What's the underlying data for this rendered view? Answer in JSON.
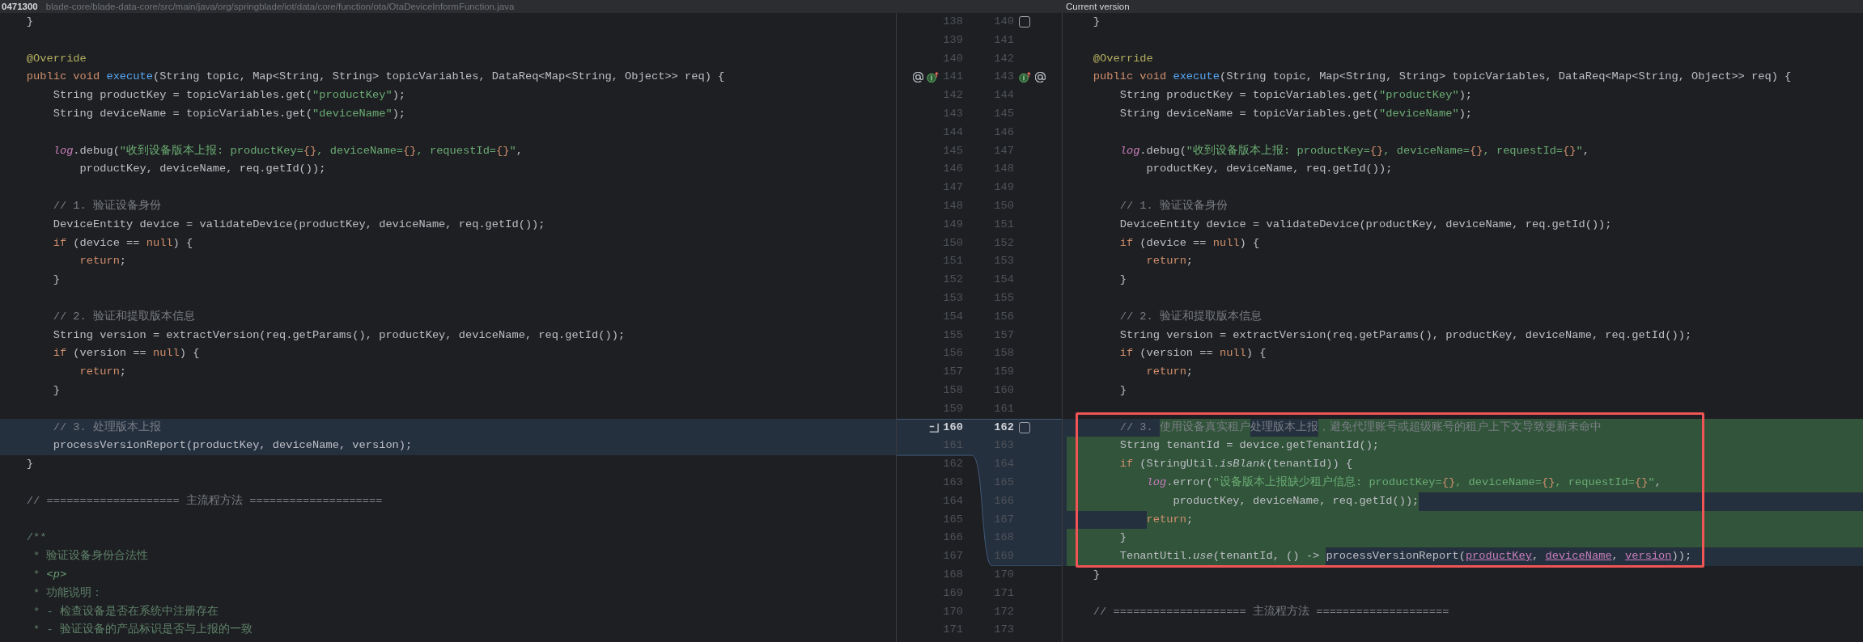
{
  "header": {
    "revision": "0471300",
    "path": "blade-core/blade-data-core/src/main/java/org/springblade/iot/data/core/function/ota/OtaDeviceInformFunction.java",
    "right_title": "Current version"
  },
  "left_pane": {
    "lines": [
      {
        "modified": false,
        "tokens": [
          {
            "kind": "plain",
            "text": "    }"
          }
        ]
      },
      {
        "modified": false
      },
      {
        "modified": false,
        "tokens": [
          {
            "kind": "annotation",
            "text": "    @Override"
          }
        ]
      },
      {
        "modified": false,
        "tokens": [
          {
            "kind": "keyword",
            "text": "    public void"
          },
          {
            "kind": "declaration",
            "text": " execute"
          },
          {
            "kind": "plain",
            "text": "(String topic, Map<String, String> topicVariables, DataReq<Map<String, Object>> req) {"
          }
        ]
      },
      {
        "modified": false,
        "tokens": [
          {
            "kind": "plain",
            "text": "        String productKey = topicVariables.get("
          },
          {
            "kind": "string",
            "text": "\"productKey\""
          },
          {
            "kind": "plain",
            "text": ");"
          }
        ]
      },
      {
        "modified": false,
        "tokens": [
          {
            "kind": "plain",
            "text": "        String deviceName = topicVariables.get("
          },
          {
            "kind": "string",
            "text": "\"deviceName\""
          },
          {
            "kind": "plain",
            "text": ");"
          }
        ]
      },
      {
        "modified": false
      },
      {
        "modified": false,
        "tokens": [
          {
            "kind": "field",
            "text": "        log"
          },
          {
            "kind": "plain",
            "text": ".debug("
          },
          {
            "kind": "string",
            "text": "\"收到设备版本上报: productKey="
          },
          {
            "kind": "placeholder",
            "text": "{}"
          },
          {
            "kind": "string",
            "text": ", deviceName="
          },
          {
            "kind": "placeholder",
            "text": "{}"
          },
          {
            "kind": "string",
            "text": ", requestId="
          },
          {
            "kind": "placeholder",
            "text": "{}"
          },
          {
            "kind": "string",
            "text": "\""
          },
          {
            "kind": "plain",
            "text": ","
          }
        ]
      },
      {
        "modified": false,
        "tokens": [
          {
            "kind": "plain",
            "text": "            productKey, deviceName, req.getId());"
          }
        ]
      },
      {
        "modified": false
      },
      {
        "modified": false,
        "tokens": [
          {
            "kind": "comment",
            "text": "        // 1. 验证设备身份"
          }
        ]
      },
      {
        "modified": false,
        "tokens": [
          {
            "kind": "plain",
            "text": "        DeviceEntity device = validateDevice(productKey, deviceName, req.getId());"
          }
        ]
      },
      {
        "modified": false,
        "tokens": [
          {
            "kind": "keyword",
            "text": "        if"
          },
          {
            "kind": "plain",
            "text": " (device == "
          },
          {
            "kind": "keyword",
            "text": "null"
          },
          {
            "kind": "plain",
            "text": ") {"
          }
        ]
      },
      {
        "modified": false,
        "tokens": [
          {
            "kind": "keyword",
            "text": "            return"
          },
          {
            "kind": "plain",
            "text": ";"
          }
        ]
      },
      {
        "modified": false,
        "tokens": [
          {
            "kind": "plain",
            "text": "        }"
          }
        ]
      },
      {
        "modified": false
      },
      {
        "modified": false,
        "tokens": [
          {
            "kind": "comment",
            "text": "        // 2. 验证和提取版本信息"
          }
        ]
      },
      {
        "modified": false,
        "tokens": [
          {
            "kind": "plain",
            "text": "        String version = extractVersion(req.getParams(), productKey, deviceName, req.getId());"
          }
        ]
      },
      {
        "modified": false,
        "tokens": [
          {
            "kind": "keyword",
            "text": "        if"
          },
          {
            "kind": "plain",
            "text": " (version == "
          },
          {
            "kind": "keyword",
            "text": "null"
          },
          {
            "kind": "plain",
            "text": ") {"
          }
        ]
      },
      {
        "modified": false,
        "tokens": [
          {
            "kind": "keyword",
            "text": "            return"
          },
          {
            "kind": "plain",
            "text": ";"
          }
        ]
      },
      {
        "modified": false,
        "tokens": [
          {
            "kind": "plain",
            "text": "        }"
          }
        ]
      },
      {
        "modified": false
      },
      {
        "modified": true,
        "tokens": [
          {
            "kind": "comment",
            "text": "        // 3. 处理版本上报"
          }
        ]
      },
      {
        "modified": true,
        "tokens": [
          {
            "kind": "plain",
            "text": "        processVersionReport(productKey, deviceName, version);"
          }
        ]
      },
      {
        "modified": false,
        "tokens": [
          {
            "kind": "plain",
            "text": "    }"
          }
        ]
      },
      {
        "modified": false
      },
      {
        "modified": false,
        "tokens": [
          {
            "kind": "comment",
            "text": "    // ==================== 主流程方法 ===================="
          }
        ]
      },
      {
        "modified": false
      },
      {
        "modified": false,
        "tokens": [
          {
            "kind": "doc",
            "text": "    /**"
          }
        ]
      },
      {
        "modified": false,
        "tokens": [
          {
            "kind": "doc",
            "text": "     * 验证设备身份合法性"
          }
        ]
      },
      {
        "modified": false,
        "tokens": [
          {
            "kind": "doc",
            "text": "     * "
          },
          {
            "kind": "doc_tag",
            "text": "<p>"
          }
        ]
      },
      {
        "modified": false,
        "tokens": [
          {
            "kind": "doc",
            "text": "     * 功能说明："
          }
        ]
      },
      {
        "modified": false,
        "tokens": [
          {
            "kind": "doc",
            "text": "     * - 检查设备是否在系统中注册存在"
          }
        ]
      },
      {
        "modified": false,
        "tokens": [
          {
            "kind": "doc",
            "text": "     * - 验证设备的产品标识是否与上报的一致"
          }
        ]
      }
    ]
  },
  "gutter": {
    "rows": [
      {
        "left_number": "138",
        "right_number": "140",
        "current": false,
        "right_icons": [
          {
            "kind": "checkbox",
            "checked": false
          }
        ]
      },
      {
        "left_number": "139",
        "right_number": "141",
        "current": false
      },
      {
        "left_number": "140",
        "right_number": "142",
        "current": false
      },
      {
        "left_number": "141",
        "right_number": "143",
        "current": false,
        "left_icons": [
          {
            "kind": "override"
          },
          {
            "kind": "implements"
          }
        ],
        "right_icons": [
          {
            "kind": "implements"
          },
          {
            "kind": "override"
          }
        ]
      },
      {
        "left_number": "142",
        "right_number": "144",
        "current": false
      },
      {
        "left_number": "143",
        "right_number": "145",
        "current": false
      },
      {
        "left_number": "144",
        "right_number": "146",
        "current": false
      },
      {
        "left_number": "145",
        "right_number": "147",
        "current": false
      },
      {
        "left_number": "146",
        "right_number": "148",
        "current": false
      },
      {
        "left_number": "147",
        "right_number": "149",
        "current": false
      },
      {
        "left_number": "148",
        "right_number": "150",
        "current": false
      },
      {
        "left_number": "149",
        "right_number": "151",
        "current": false
      },
      {
        "left_number": "150",
        "right_number": "152",
        "current": false
      },
      {
        "left_number": "151",
        "right_number": "153",
        "current": false
      },
      {
        "left_number": "152",
        "right_number": "154",
        "current": false
      },
      {
        "left_number": "153",
        "right_number": "155",
        "current": false
      },
      {
        "left_number": "154",
        "right_number": "156",
        "current": false
      },
      {
        "left_number": "155",
        "right_number": "157",
        "current": false
      },
      {
        "left_number": "156",
        "right_number": "158",
        "current": false
      },
      {
        "left_number": "157",
        "right_number": "159",
        "current": false
      },
      {
        "left_number": "158",
        "right_number": "160",
        "current": false
      },
      {
        "left_number": "159",
        "right_number": "161",
        "current": false
      },
      {
        "left_number": "160",
        "right_number": "162",
        "current": true,
        "left_icons": [
          {
            "kind": "revert"
          }
        ],
        "right_icons": [
          {
            "kind": "checkbox",
            "checked": false
          }
        ]
      },
      {
        "left_number": "161",
        "right_number": "163",
        "current": false
      },
      {
        "left_number": "162",
        "right_number": "164",
        "current": false
      },
      {
        "left_number": "163",
        "right_number": "165",
        "current": false
      },
      {
        "left_number": "164",
        "right_number": "166",
        "current": false
      },
      {
        "left_number": "165",
        "right_number": "167",
        "current": false
      },
      {
        "left_number": "166",
        "right_number": "168",
        "current": false
      },
      {
        "left_number": "167",
        "right_number": "169",
        "current": false
      },
      {
        "left_number": "168",
        "right_number": "170",
        "current": false
      },
      {
        "left_number": "169",
        "right_number": "171",
        "current": false
      },
      {
        "left_number": "170",
        "right_number": "172",
        "current": false
      },
      {
        "left_number": "171",
        "right_number": "173",
        "current": false
      }
    ]
  },
  "right_pane": {
    "lines": [
      {
        "modified": false,
        "tokens": [
          {
            "kind": "plain",
            "text": "    }"
          }
        ]
      },
      {
        "modified": false
      },
      {
        "modified": false,
        "tokens": [
          {
            "kind": "annotation",
            "text": "    @Override"
          }
        ]
      },
      {
        "modified": false,
        "tokens": [
          {
            "kind": "keyword",
            "text": "    public void"
          },
          {
            "kind": "declaration",
            "text": " execute"
          },
          {
            "kind": "plain",
            "text": "(String topic, Map<String, String> topicVariables, DataReq<Map<String, Object>> req) {"
          }
        ]
      },
      {
        "modified": false,
        "tokens": [
          {
            "kind": "plain",
            "text": "        String productKey = topicVariables.get("
          },
          {
            "kind": "string",
            "text": "\"productKey\""
          },
          {
            "kind": "plain",
            "text": ");"
          }
        ]
      },
      {
        "modified": false,
        "tokens": [
          {
            "kind": "plain",
            "text": "        String deviceName = topicVariables.get("
          },
          {
            "kind": "string",
            "text": "\"deviceName\""
          },
          {
            "kind": "plain",
            "text": ");"
          }
        ]
      },
      {
        "modified": false
      },
      {
        "modified": false,
        "tokens": [
          {
            "kind": "field",
            "text": "        log"
          },
          {
            "kind": "plain",
            "text": ".debug("
          },
          {
            "kind": "string",
            "text": "\"收到设备版本上报: productKey="
          },
          {
            "kind": "placeholder",
            "text": "{}"
          },
          {
            "kind": "string",
            "text": ", deviceName="
          },
          {
            "kind": "placeholder",
            "text": "{}"
          },
          {
            "kind": "string",
            "text": ", requestId="
          },
          {
            "kind": "placeholder",
            "text": "{}"
          },
          {
            "kind": "string",
            "text": "\""
          },
          {
            "kind": "plain",
            "text": ","
          }
        ]
      },
      {
        "modified": false,
        "tokens": [
          {
            "kind": "plain",
            "text": "            productKey, deviceName, req.getId());"
          }
        ]
      },
      {
        "modified": false
      },
      {
        "modified": false,
        "tokens": [
          {
            "kind": "comment",
            "text": "        // 1. 验证设备身份"
          }
        ]
      },
      {
        "modified": false,
        "tokens": [
          {
            "kind": "plain",
            "text": "        DeviceEntity device = validateDevice(productKey, deviceName, req.getId());"
          }
        ]
      },
      {
        "modified": false,
        "tokens": [
          {
            "kind": "keyword",
            "text": "        if"
          },
          {
            "kind": "plain",
            "text": " (device == "
          },
          {
            "kind": "keyword",
            "text": "null"
          },
          {
            "kind": "plain",
            "text": ") {"
          }
        ]
      },
      {
        "modified": false,
        "tokens": [
          {
            "kind": "keyword",
            "text": "            return"
          },
          {
            "kind": "plain",
            "text": ";"
          }
        ]
      },
      {
        "modified": false,
        "tokens": [
          {
            "kind": "plain",
            "text": "        }"
          }
        ]
      },
      {
        "modified": false
      },
      {
        "modified": false,
        "tokens": [
          {
            "kind": "comment",
            "text": "        // 2. 验证和提取版本信息"
          }
        ]
      },
      {
        "modified": false,
        "tokens": [
          {
            "kind": "plain",
            "text": "        String version = extractVersion(req.getParams(), productKey, deviceName, req.getId());"
          }
        ]
      },
      {
        "modified": false,
        "tokens": [
          {
            "kind": "keyword",
            "text": "        if"
          },
          {
            "kind": "plain",
            "text": " (version == "
          },
          {
            "kind": "keyword",
            "text": "null"
          },
          {
            "kind": "plain",
            "text": ") {"
          }
        ]
      },
      {
        "modified": false,
        "tokens": [
          {
            "kind": "keyword",
            "text": "            return"
          },
          {
            "kind": "plain",
            "text": ";"
          }
        ]
      },
      {
        "modified": false,
        "tokens": [
          {
            "kind": "plain",
            "text": "        }"
          }
        ]
      },
      {
        "modified": false
      },
      {
        "modified": true,
        "indent_inserted": false,
        "end_inserted": true,
        "tokens": [
          {
            "kind": "comment",
            "text": "        // 3. ",
            "inserted": false
          },
          {
            "kind": "comment",
            "text": "使用设备真实租户",
            "inserted": true
          },
          {
            "kind": "comment",
            "text": "处理版本上报",
            "inserted": false
          },
          {
            "kind": "comment",
            "text": "，避免代理账号或超级账号的租户上下文导致更新未命中",
            "inserted": true
          }
        ]
      },
      {
        "modified": true,
        "indent_inserted": true,
        "end_inserted": true,
        "tokens": [
          {
            "kind": "plain",
            "text": "        String tenantId = device.getTenantId();",
            "inserted": true
          }
        ]
      },
      {
        "modified": true,
        "indent_inserted": true,
        "end_inserted": true,
        "tokens": [
          {
            "kind": "keyword",
            "text": "        if",
            "inserted": true
          },
          {
            "kind": "plain",
            "text": " (StringUtil.",
            "inserted": true
          },
          {
            "kind": "static_call",
            "text": "isBlank",
            "inserted": true
          },
          {
            "kind": "plain",
            "text": "(tenantId)) {",
            "inserted": true
          }
        ]
      },
      {
        "modified": true,
        "indent_inserted": true,
        "end_inserted": true,
        "tokens": [
          {
            "kind": "field",
            "text": "            log",
            "inserted": true
          },
          {
            "kind": "plain",
            "text": ".error(",
            "inserted": true
          },
          {
            "kind": "string",
            "text": "\"设备版本上报缺少租户信息: productKey=",
            "inserted": true
          },
          {
            "kind": "placeholder",
            "text": "{}",
            "inserted": true
          },
          {
            "kind": "string",
            "text": ", deviceName=",
            "inserted": true
          },
          {
            "kind": "placeholder",
            "text": "{}",
            "inserted": true
          },
          {
            "kind": "string",
            "text": ", requestId=",
            "inserted": true
          },
          {
            "kind": "placeholder",
            "text": "{}",
            "inserted": true
          },
          {
            "kind": "string",
            "text": "\"",
            "inserted": true
          },
          {
            "kind": "plain",
            "text": ",",
            "inserted": true
          }
        ]
      },
      {
        "modified": true,
        "indent_inserted": true,
        "end_inserted": false,
        "tokens": [
          {
            "kind": "plain",
            "text": "                productKey, deviceName, req.getId());",
            "inserted": true
          }
        ]
      },
      {
        "modified": true,
        "indent_inserted": false,
        "end_inserted": true,
        "tokens": [
          {
            "kind": "keyword",
            "text": "            return",
            "inserted": true
          },
          {
            "kind": "plain",
            "text": ";",
            "inserted": true
          }
        ]
      },
      {
        "modified": true,
        "indent_inserted": true,
        "end_inserted": true,
        "tokens": [
          {
            "kind": "plain",
            "text": "        }",
            "inserted": true
          }
        ]
      },
      {
        "modified": true,
        "indent_inserted": true,
        "end_inserted": false,
        "tokens": [
          {
            "kind": "plain",
            "text": "        TenantUtil.",
            "inserted": true
          },
          {
            "kind": "static_call",
            "text": "use",
            "inserted": true
          },
          {
            "kind": "plain",
            "text": "(tenantId, () -> ",
            "inserted": true
          },
          {
            "kind": "plain",
            "text": "processVersionReport(",
            "inserted": false
          },
          {
            "kind": "captured",
            "text": "productKey",
            "inserted": false
          },
          {
            "kind": "plain",
            "text": ", ",
            "inserted": false
          },
          {
            "kind": "captured",
            "text": "deviceName",
            "inserted": false
          },
          {
            "kind": "plain",
            "text": ", ",
            "inserted": false
          },
          {
            "kind": "captured",
            "text": "version",
            "inserted": false
          },
          {
            "kind": "plain",
            "text": "));",
            "inserted": false
          }
        ]
      },
      {
        "modified": false,
        "tokens": [
          {
            "kind": "plain",
            "text": "    }"
          }
        ]
      },
      {
        "modified": false
      },
      {
        "modified": false,
        "tokens": [
          {
            "kind": "comment",
            "text": "    // ==================== 主流程方法 ===================="
          }
        ]
      },
      {
        "modified": false
      }
    ]
  }
}
